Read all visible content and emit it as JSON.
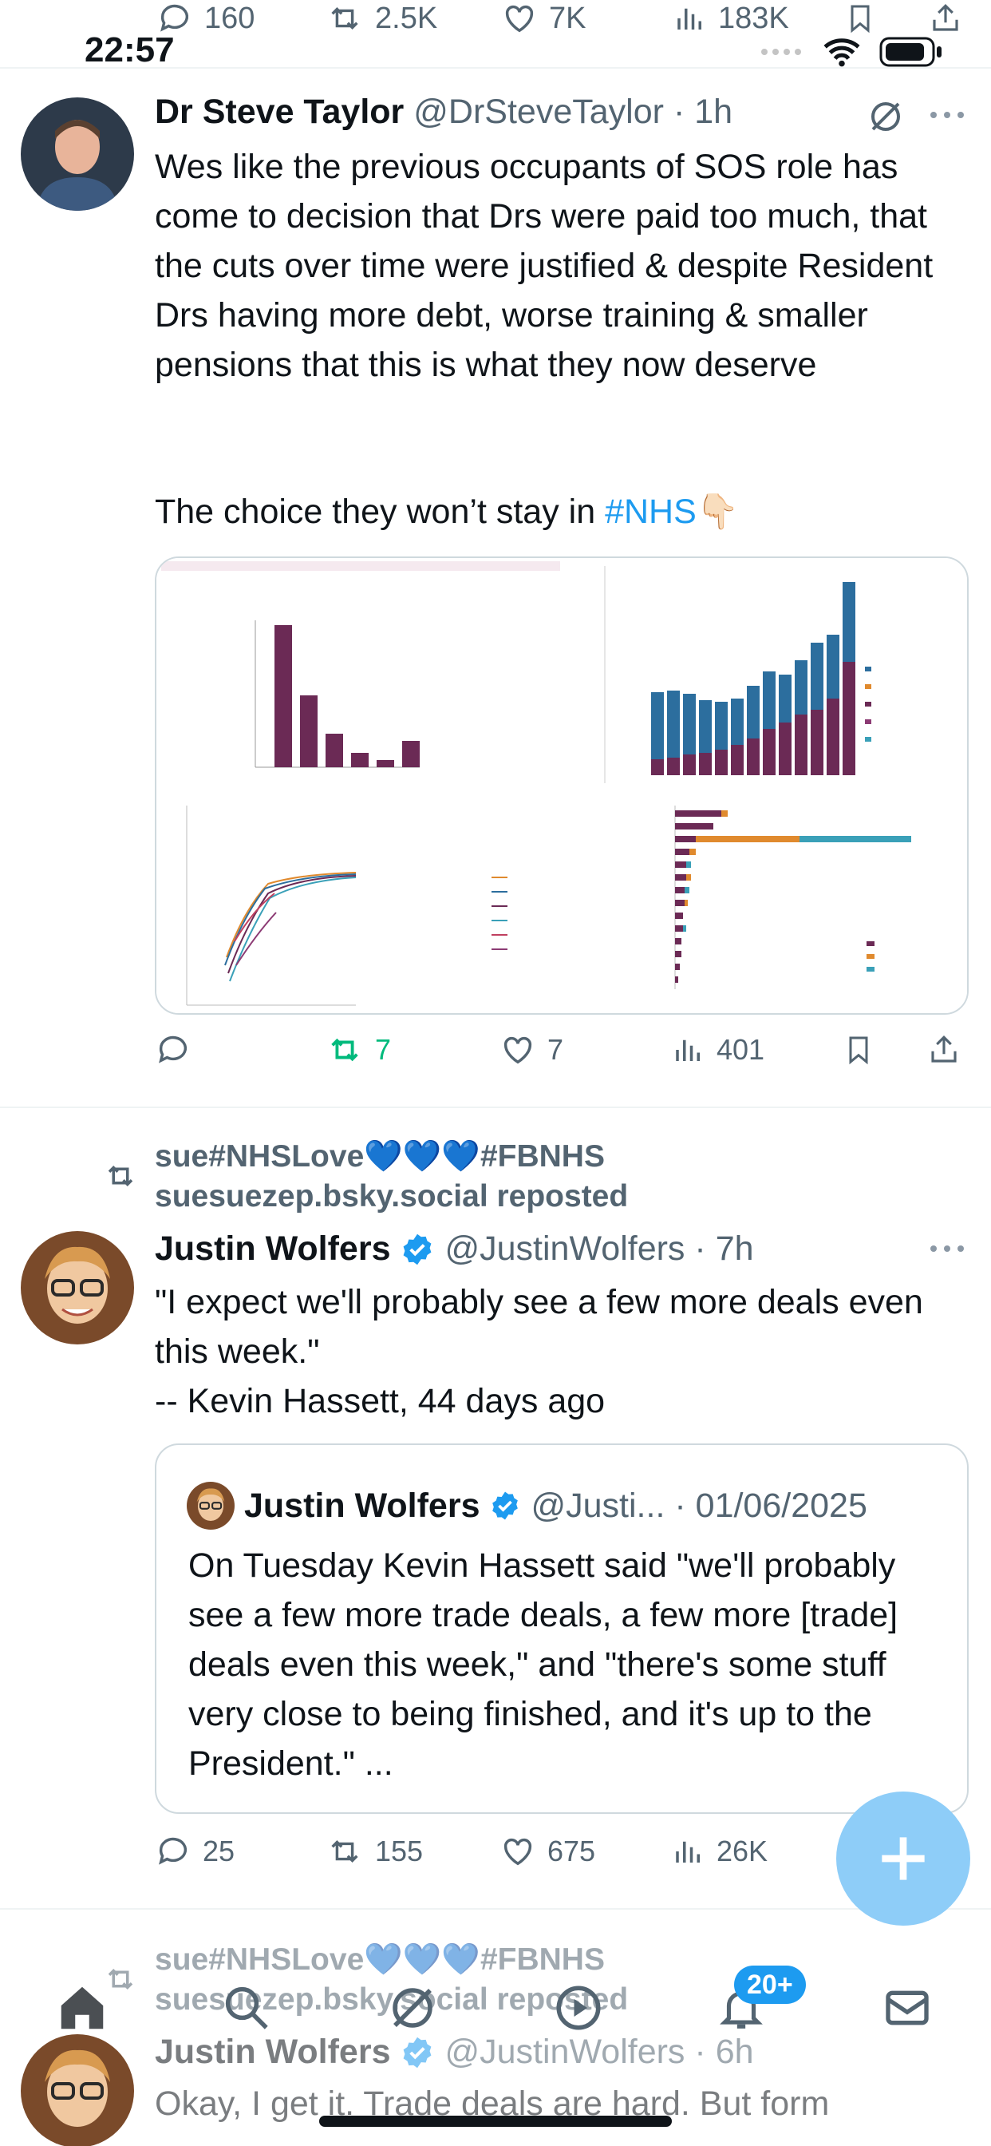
{
  "status_bar": {
    "time": "22:57"
  },
  "prev_tweet_actions": {
    "replies": "160",
    "reposts": "2.5K",
    "likes": "7K",
    "views": "183K"
  },
  "tweet1": {
    "name": "Dr Steve Taylor",
    "handle": "@DrSteveTaylor",
    "time": "· 1h",
    "text": "Wes like the previous occupants of SOS role has come to decision that Drs were paid too much, that the cuts over time were justified & despite Resident Drs having more debt, worse training & smaller pensions that this is what they now deserve",
    "text2_prefix": "The choice they won’t stay in ",
    "hashtag": "#NHS",
    "emoji": "👇🏻",
    "actions": {
      "replies": "",
      "reposts": "7",
      "likes": "7",
      "views": "401"
    }
  },
  "tweet2": {
    "repost_line1": "sue#NHSLove💙💙💙#FBNHS",
    "repost_line2": "suesuezep.bsky.social reposted",
    "name": "Justin Wolfers",
    "handle": "@JustinWolfers",
    "time": "· 7h",
    "text": "\"I expect we'll probably see a few more deals even this week.\"\n-- Kevin Hassett, 44 days ago",
    "quote": {
      "name": "Justin Wolfers",
      "handle": "@Justi...",
      "date": "· 01/06/2025",
      "text": "On Tuesday Kevin Hassett said \"we'll probably see a few more trade deals, a few more [trade] deals even this week,\" and \"there's some stuff very close to being finished, and it's up to the President.\" ..."
    },
    "actions": {
      "replies": "25",
      "reposts": "155",
      "likes": "675",
      "views": "26K"
    }
  },
  "tweet3": {
    "repost_line1": "sue#NHSLove💙💙💙#FBNHS",
    "repost_line2": "suesuezep.bsky.social reposted",
    "name": "Justin Wolfers",
    "handle": "@JustinWolfers",
    "time": "· 6h",
    "text": "Okay, I get it. Trade deals are hard. But form"
  },
  "tabbar": {
    "notifications_badge": "20+"
  },
  "colors": {
    "accent": "#1d9bf0",
    "repost_green": "#00ba7c",
    "muted": "#536471",
    "fab": "#8ecdf8",
    "verified": "#1d9bf0"
  }
}
